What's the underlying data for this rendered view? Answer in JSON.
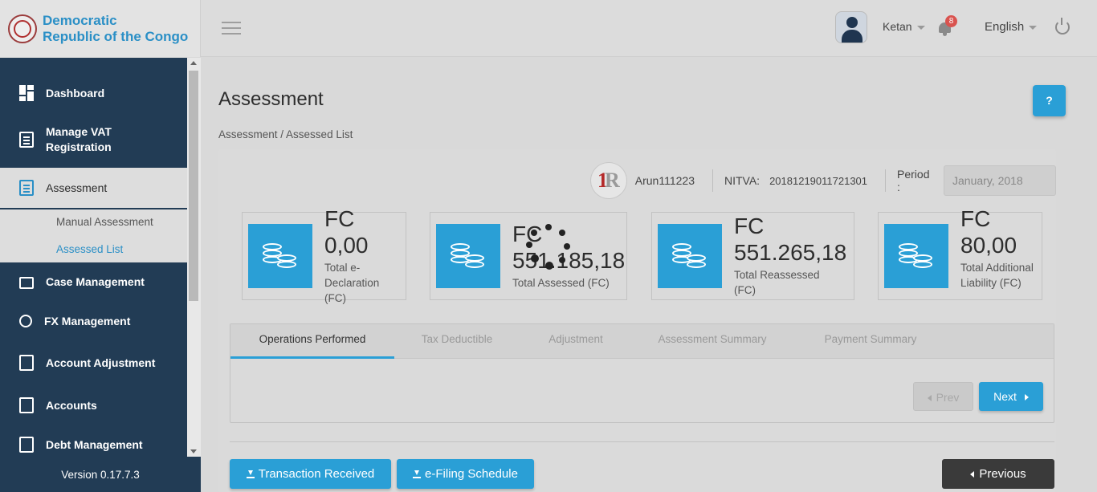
{
  "header": {
    "brand_line1": "Democratic",
    "brand_line2": "Republic of the Congo",
    "username": "Ketan",
    "notification_count": "8",
    "language": "English"
  },
  "sidebar": {
    "items": [
      {
        "label": "Dashboard",
        "icon": "dashboard-icon"
      },
      {
        "label": "Manage VAT Registration",
        "icon": "registration-icon"
      },
      {
        "label": "Assessment",
        "icon": "assessment-icon"
      },
      {
        "label": "Case Management",
        "icon": "folder-icon"
      },
      {
        "label": "FX Management",
        "icon": "currency-exchange-icon"
      },
      {
        "label": "Account Adjustment",
        "icon": "calculator-icon"
      },
      {
        "label": "Accounts",
        "icon": "receipt-icon"
      },
      {
        "label": "Debt Management",
        "icon": "debt-icon"
      }
    ],
    "subitems": [
      {
        "label": "Manual Assessment"
      },
      {
        "label": "Assessed List"
      }
    ],
    "version": "Version 0.17.7.3"
  },
  "main": {
    "title": "Assessment",
    "help_label": "?",
    "breadcrumb": {
      "root": "Assessment",
      "separator": " / ",
      "current": "Assessed List"
    }
  },
  "taxpayer": {
    "name": "Arun111223",
    "nitva_label": "NITVA:",
    "nitva_value": "20181219011721301",
    "period_label": "Period :",
    "period_value": "January, 2018"
  },
  "cards": [
    {
      "currency": "FC",
      "amount": "0,00",
      "label": "Total e-Declaration (FC)"
    },
    {
      "currency": "FC",
      "amount": "551.185,18",
      "label": "Total Assessed (FC)"
    },
    {
      "currency": "FC",
      "amount": "551.265,18",
      "label": "Total Reassessed (FC)"
    },
    {
      "currency": "FC",
      "amount": "80,00",
      "label": "Total Additional Liability (FC)"
    }
  ],
  "tabs": [
    {
      "label": "Operations Performed"
    },
    {
      "label": "Tax Deductible"
    },
    {
      "label": "Adjustment"
    },
    {
      "label": "Assessment Summary"
    },
    {
      "label": "Payment Summary"
    }
  ],
  "buttons": {
    "prev": "Prev",
    "next": "Next",
    "transaction_received": "Transaction Received",
    "efiling_schedule": "e-Filing Schedule",
    "previous": "Previous"
  },
  "colors": {
    "accent": "#2a9fd6",
    "sidebar": "#223c55",
    "badge": "#d9534f"
  }
}
